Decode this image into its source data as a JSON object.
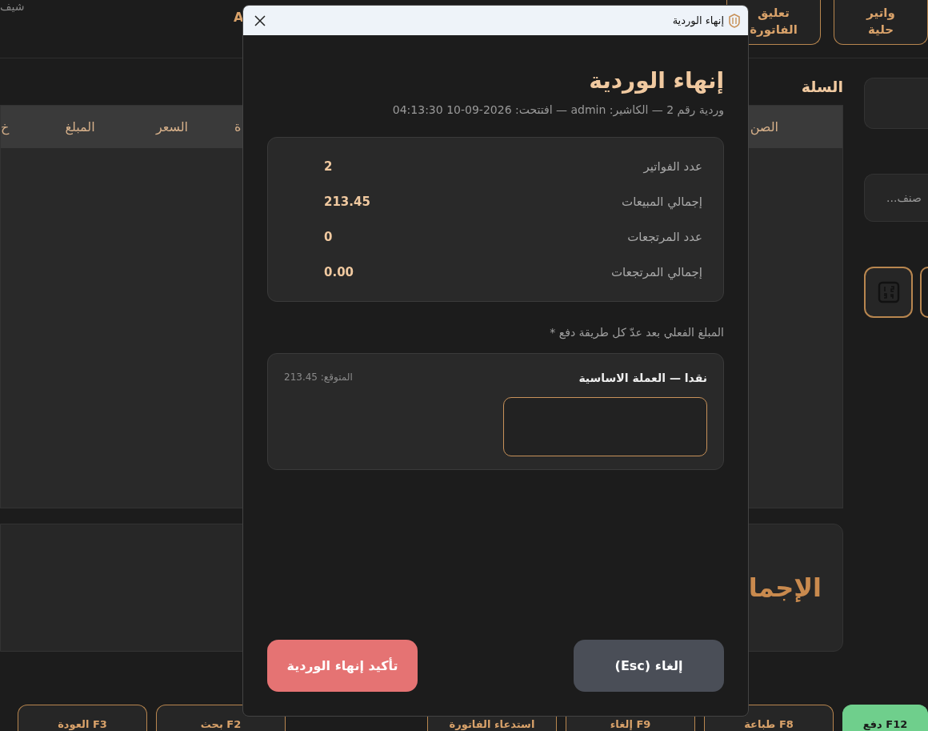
{
  "topbar": {
    "brand": "شيف",
    "label": "A",
    "buttons": [
      {
        "lines": [
          "واتير",
          "حلية"
        ]
      },
      {
        "lines": [
          "تعليق",
          "الفاتورة"
        ]
      }
    ]
  },
  "sidebar": {
    "search_placeholder": "صنف...",
    "keypad_selected": false
  },
  "cart": {
    "title": "السلة",
    "columns": [
      "الصن",
      "ة",
      "السعر",
      "المبلغ",
      "خ"
    ],
    "total_label": "الإجما"
  },
  "bottom_buttons": [
    {
      "label": "F12 دفع",
      "kind": "primary"
    },
    {
      "label": "F8 طباعة",
      "kind": "outline"
    },
    {
      "label": "F9 إلغاء",
      "kind": "outline"
    },
    {
      "label": "استدعاء الفاتورة",
      "kind": "outline"
    },
    {
      "label": "F2 بحث",
      "kind": "outline"
    },
    {
      "label": "F3 العودة",
      "kind": "outline"
    }
  ],
  "dialog": {
    "window_title": "إنهاء الوردية",
    "title": "إنهاء الوردية",
    "subtitle": "وردية رقم 2 — الكاشير: admin — افتتحت: 2026-09-10 04:13:30",
    "stats": [
      {
        "label": "عدد الفواتير",
        "value": "2"
      },
      {
        "label": "إجمالي المبيعات",
        "value": "213.45"
      },
      {
        "label": "عدد المرتجعات",
        "value": "0"
      },
      {
        "label": "إجمالي المرتجعات",
        "value": "0.00"
      }
    ],
    "count_label": "المبلغ الفعلي بعد عدّ كل طريقة دفع *",
    "payments": [
      {
        "name": "نقدا — العملة الاساسية",
        "expected": "المتوقع: 213.45"
      }
    ],
    "buttons": [
      {
        "label": "إلغاء (Esc)",
        "kind": "cancel"
      },
      {
        "label": "تأكيد إنهاء الوردية",
        "kind": "danger"
      }
    ]
  }
}
